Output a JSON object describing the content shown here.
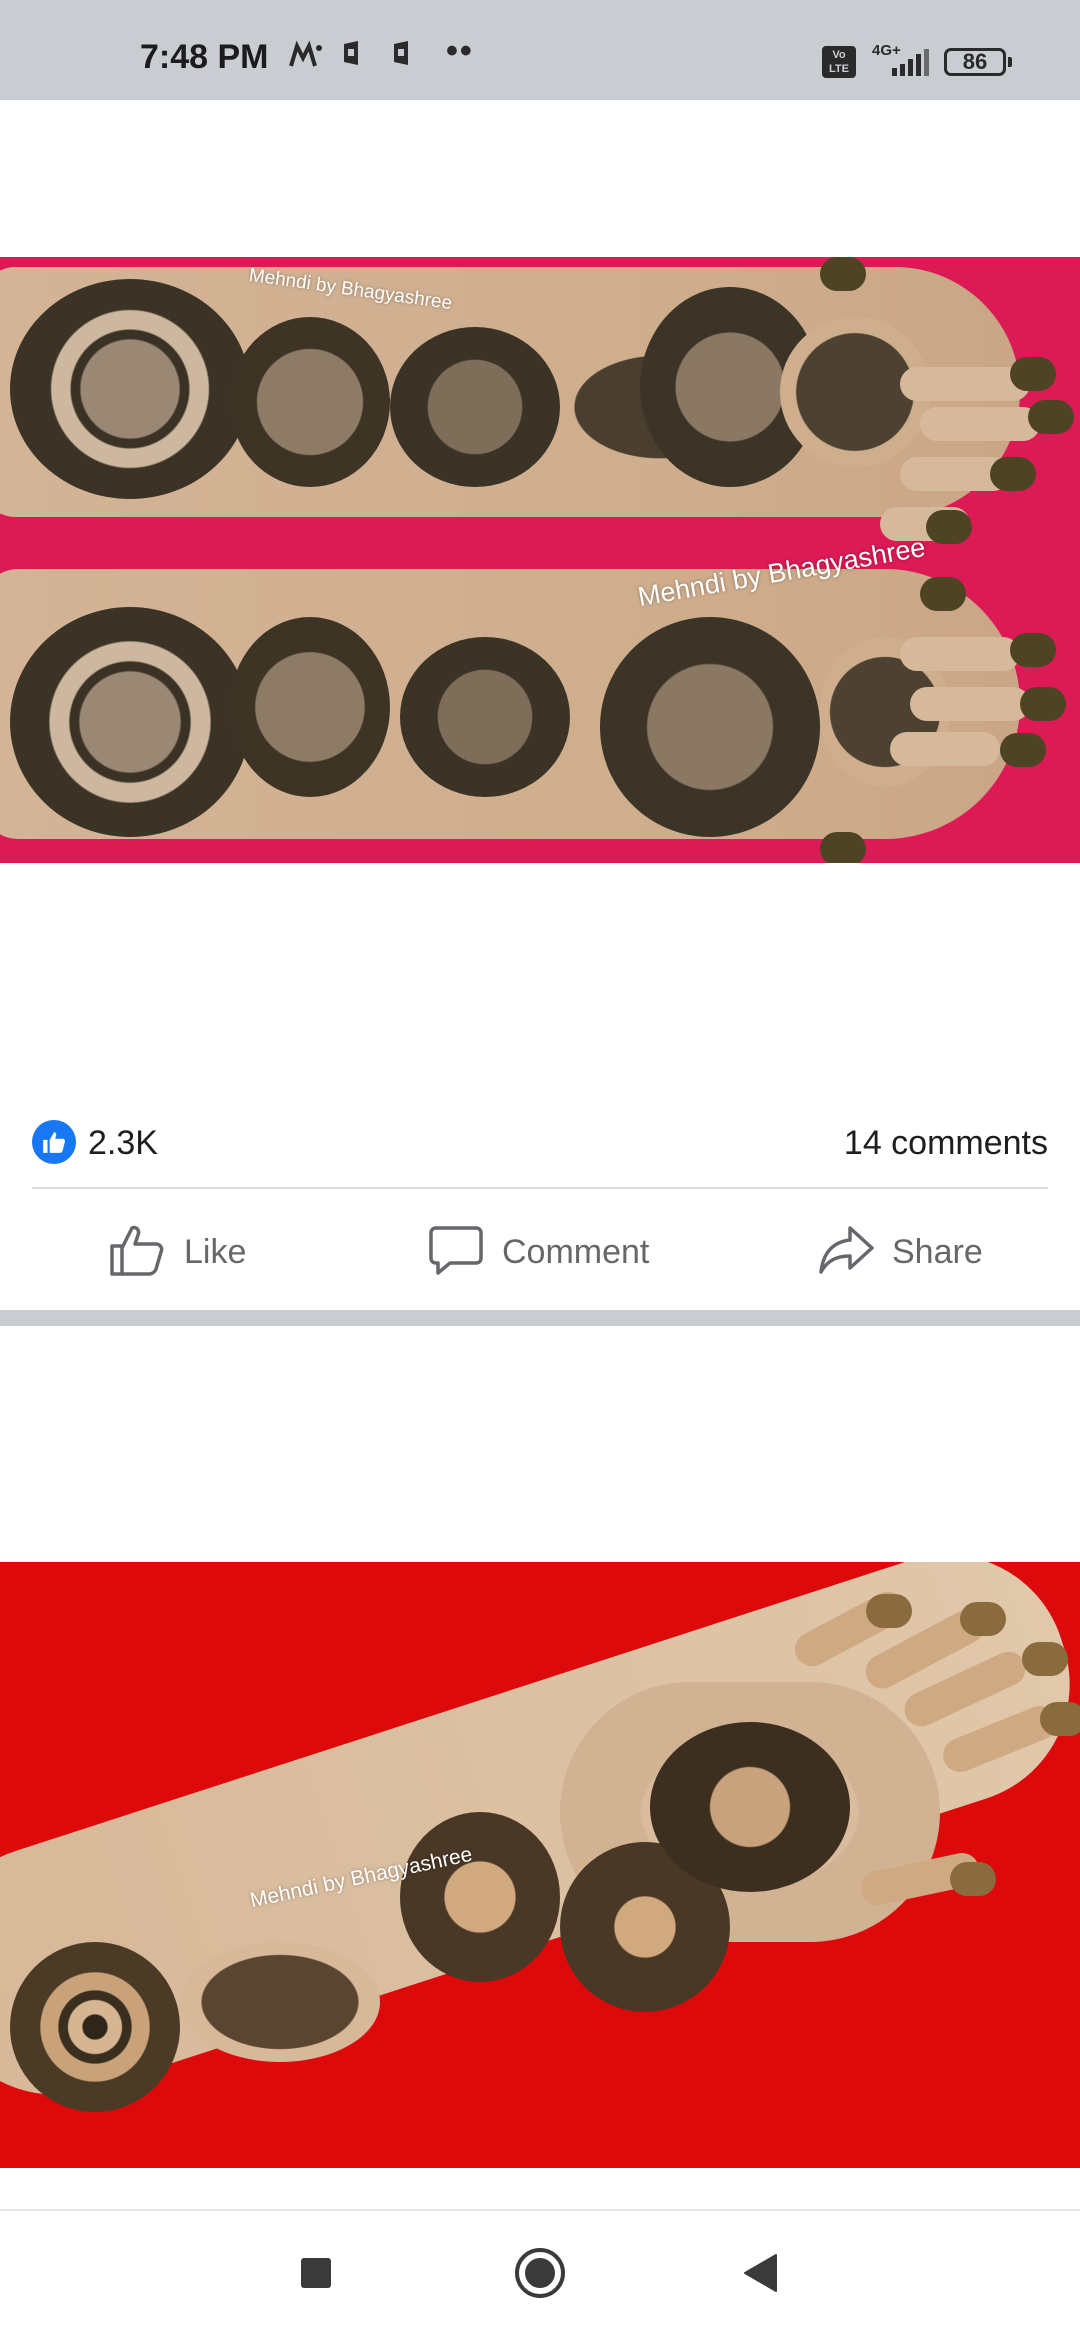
{
  "status_bar": {
    "time": "7:48 PM",
    "network_type": "4G+",
    "volte_label": "Vo LTE",
    "battery_level": "86",
    "notification_icons": [
      "myjio-icon",
      "notification-icon",
      "notification-icon",
      "more-dots"
    ]
  },
  "posts": [
    {
      "image": {
        "description_icon": "mehndi-photo",
        "watermarks": [
          "Mehndi by Bhagyashree",
          "Mehndi by Bhagyashree"
        ]
      },
      "reactions": {
        "likes": "2.3K",
        "comments": "14 comments"
      },
      "actions": {
        "like": "Like",
        "comment": "Comment",
        "share": "Share"
      }
    },
    {
      "image": {
        "description_icon": "mehndi-photo",
        "watermarks": [
          "Mehndi by Bhagyashree"
        ]
      }
    }
  ],
  "colors": {
    "brand_blue": "#1877f2",
    "action_gray": "#65676b",
    "status_bar_bg": "#c9ccd1",
    "photo1_bg": "#dc1a55",
    "photo2_bg": "#dc0a0a"
  },
  "nav_bar": {
    "icons": [
      "recents-square-icon",
      "home-circle-icon",
      "back-triangle-icon"
    ]
  }
}
